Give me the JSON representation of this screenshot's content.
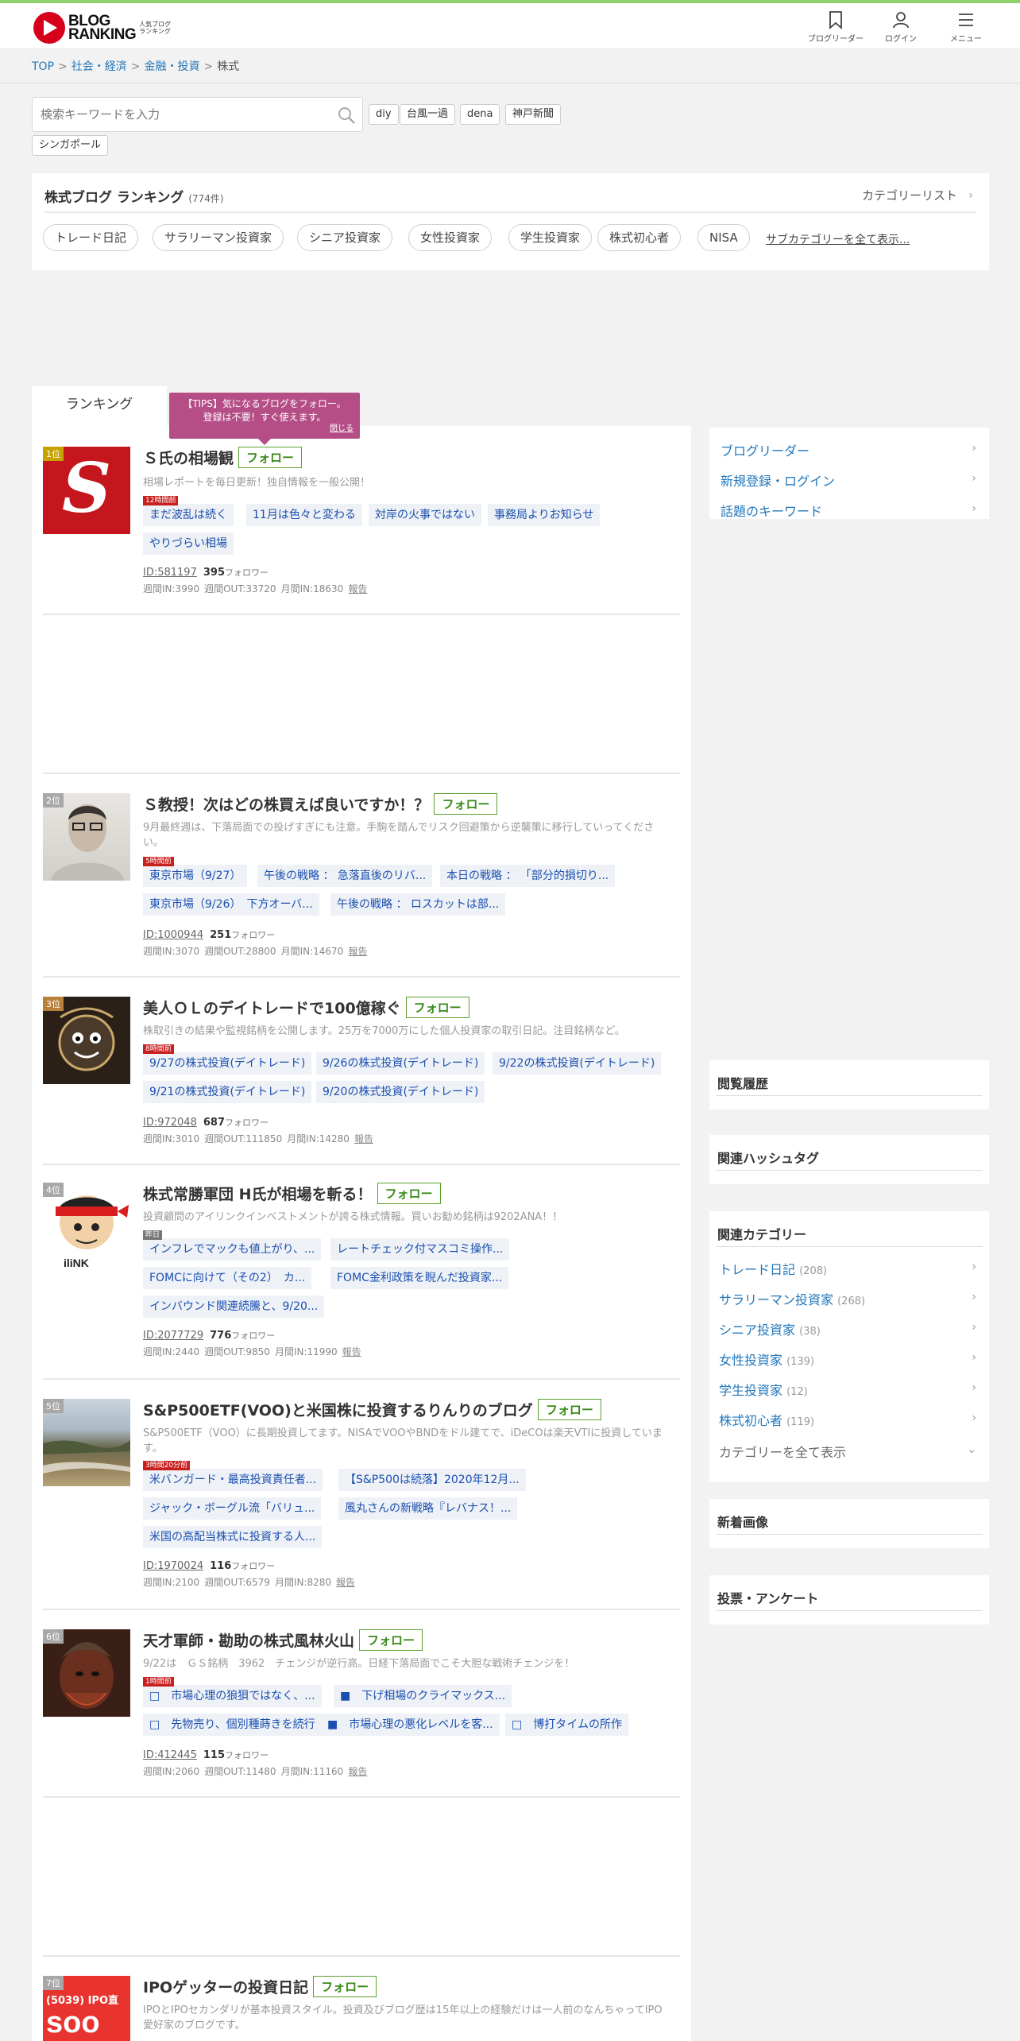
{
  "header": {
    "logo_text_line1": "BLOG",
    "logo_text_line2": "RANKING",
    "logo_sub": "人気ブログランキング",
    "nav": [
      {
        "label": "ブログリーダー",
        "icon": "bookmark-icon"
      },
      {
        "label": "ログイン",
        "icon": "user-icon"
      },
      {
        "label": "メニュー",
        "icon": "hamburger-icon"
      }
    ]
  },
  "breadcrumb": [
    "TOP",
    "社会・経済",
    "金融・投資",
    "株式"
  ],
  "search": {
    "placeholder": "検索キーワードを入力",
    "keywords": [
      "diy",
      "台風一過",
      "dena",
      "神戸新聞",
      "シンガポール"
    ]
  },
  "category": {
    "title": "株式ブログ ランキング",
    "count": "(774件)",
    "list_link": "カテゴリーリスト",
    "subcategories": [
      "トレード日記",
      "サラリーマン投資家",
      "シニア投資家",
      "女性投資家",
      "学生投資家",
      "株式初心者",
      "NISA"
    ],
    "show_all": "サブカテゴリーを全て表示..."
  },
  "tabs": {
    "ranking": "ランキング"
  },
  "tips": {
    "line1": "【TIPS】気になるブログをフォロー。",
    "line2": "登録は不要！すぐ使えます。",
    "close": "閉じる"
  },
  "entries": [
    {
      "rank": "1位",
      "title": "Ｓ氏の相場観",
      "follow": "フォロー",
      "desc": "相場レポートを毎日更新！独自情報を一般公開！",
      "new_label": "12時間前",
      "articles": [
        "まだ波乱は続く",
        "11月は色々と変わる",
        "対岸の火事ではない",
        "事務局よりお知らせ",
        "やりづらい相場"
      ],
      "id": "ID:581197",
      "followers": "395",
      "followers_label": "フォロワー",
      "week_in": "週間IN:3990",
      "week_out": "週間OUT:33720",
      "month_in": "月間IN:18630",
      "report": "報告"
    },
    {
      "rank": "2位",
      "title": "Ｓ教授！次はどの株買えば良いですか！？",
      "follow": "フォロー",
      "desc": "9月最終週は、下落局面での投げすぎにも注意。手駒を踏んでリスク回避策から逆襲策に移行していってください。",
      "new_label": "5時間前",
      "articles": [
        "東京市場（9/27）",
        "午後の戦略 ： 急落直後のリバ...",
        "本日の戦略 ： 「部分的損切り...",
        "東京市場（9/26）　下方オーバ...",
        "午後の戦略 ： ロスカットは部..."
      ],
      "id": "ID:1000944",
      "followers": "251",
      "followers_label": "フォロワー",
      "week_in": "週間IN:3070",
      "week_out": "週間OUT:28800",
      "month_in": "月間IN:14670",
      "report": "報告"
    },
    {
      "rank": "3位",
      "title": "美人ＯＬのデイトレードで100億稼ぐ",
      "follow": "フォロー",
      "desc": "株取引きの結果や監視銘柄を公開します。25万を7000万にした個人投資家の取引日記。注目銘柄など。",
      "new_label": "8時間前",
      "articles": [
        "9/27の株式投資(デイトレード)",
        "9/26の株式投資(デイトレード)",
        "9/22の株式投資(デイトレード)",
        "9/21の株式投資(デイトレード)",
        "9/20の株式投資(デイトレード)"
      ],
      "id": "ID:972048",
      "followers": "687",
      "followers_label": "フォロワー",
      "week_in": "週間IN:3010",
      "week_out": "週間OUT:111850",
      "month_in": "月間IN:14280",
      "report": "報告"
    },
    {
      "rank": "4位",
      "title": "株式常勝軍団 H氏が相場を斬る！",
      "follow": "フォロー",
      "desc": "投資顧問のアイリンクインベストメントが誇る株式情報。買いお勧め銘柄は9202ANA！！",
      "new_label": "昨日",
      "articles": [
        "インフレでマックも値上がり、...",
        "レートチェック付マスコミ操作...",
        "FOMCに向けて（その2）　カ...",
        "FOMC金利政策を睨んだ投資家...",
        "インバウンド関連続騰と、9/20..."
      ],
      "id": "ID:2077729",
      "followers": "776",
      "followers_label": "フォロワー",
      "week_in": "週間IN:2440",
      "week_out": "週間OUT:9850",
      "month_in": "月間IN:11990",
      "report": "報告"
    },
    {
      "rank": "5位",
      "title": "S&P500ETF(VOO)と米国株に投資するりんりのブログ",
      "follow": "フォロー",
      "desc": "S&P500ETF（VOO）に長期投資してます。NISAでVOOやBNDをドル建てで、iDeCOは楽天VTIに投資しています。",
      "new_label": "3時間20分前",
      "articles": [
        "米バンガード・最高投資責任者...",
        "【S&P500は続落】2020年12月...",
        "ジャック・ボーグル流「バリュ...",
        "風丸さんの新戦略『レバナス！...",
        "米国の高配当株式に投資する人..."
      ],
      "id": "ID:1970024",
      "followers": "116",
      "followers_label": "フォロワー",
      "week_in": "週間IN:2100",
      "week_out": "週間OUT:6579",
      "month_in": "月間IN:8280",
      "report": "報告"
    },
    {
      "rank": "6位",
      "title": "天才軍師・勘助の株式風林火山",
      "follow": "フォロー",
      "desc": "9/22は　ＧＳ銘柄　3962　チェンジが逆行高。日経下落局面でこそ大胆な戦術チェンジを！",
      "new_label": "1時間前",
      "articles": [
        "□　市場心理の狼狽ではなく、...",
        "■　下げ相場のクライマックス...",
        "□　先物売り、個別種蒔きを続行",
        "■　市場心理の悪化レベルを客...",
        "□　博打タイムの所作"
      ],
      "id": "ID:412445",
      "followers": "115",
      "followers_label": "フォロワー",
      "week_in": "週間IN:2060",
      "week_out": "週間OUT:11480",
      "month_in": "月間IN:11160",
      "report": "報告"
    },
    {
      "rank": "7位",
      "title": "IPOゲッターの投資日記",
      "follow": "フォロー",
      "desc": "IPOとIPOセカンダリが基本投資スタイル。投資及びブログ歴は15年以上の経験だけは一人前のなんちゃってIPO愛好家のブログです。",
      "thumb_text1": "(5039) IPO直",
      "thumb_text2": "soo"
    }
  ],
  "sidebar": {
    "links": [
      "ブログリーダー",
      "新規登録・ログイン",
      "話題のキーワード"
    ],
    "history_title": "閲覧履歴",
    "hashtag_title": "関連ハッシュタグ",
    "related_title": "関連カテゴリー",
    "related": [
      {
        "name": "トレード日記",
        "count": "(208)"
      },
      {
        "name": "サラリーマン投資家",
        "count": "(268)"
      },
      {
        "name": "シニア投資家",
        "count": "(38)"
      },
      {
        "name": "女性投資家",
        "count": "(139)"
      },
      {
        "name": "学生投資家",
        "count": "(12)"
      },
      {
        "name": "株式初心者",
        "count": "(119)"
      }
    ],
    "show_all_categories": "カテゴリーを全て表示",
    "new_images_title": "新着画像",
    "vote_title": "投票・アンケート"
  }
}
